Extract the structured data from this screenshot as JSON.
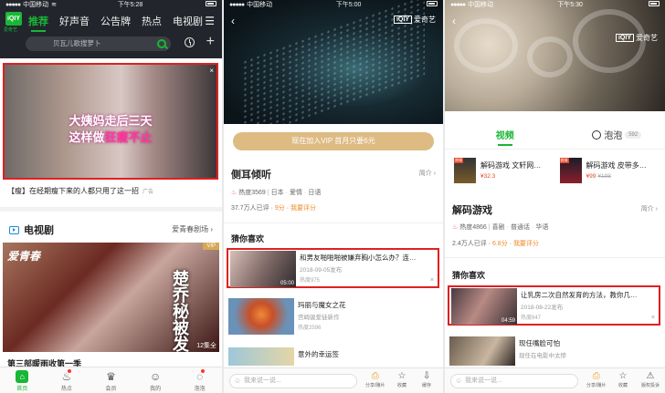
{
  "left": {
    "status": {
      "carrier": "中国移动",
      "time": "下午5:28"
    },
    "logo": {
      "text": "iQIY",
      "sub": "爱奇艺"
    },
    "nav": [
      "推荐",
      "好声音",
      "公告牌",
      "热点",
      "电视剧"
    ],
    "search_placeholder": "贝瓦儿歌搜萝卜",
    "ad": {
      "line1": "大姨妈走后三天",
      "line2a": "这样做",
      "line2b": "狂瘦不止",
      "close": "×"
    },
    "ad_caption": "【瘦】在经期瘦下来的人都只用了这一招",
    "ad_tag": "广告",
    "section": {
      "title": "电视剧",
      "more": "爱青春剧场"
    },
    "drama": {
      "vip": "VIP",
      "logo": "爱青春",
      "callig": "楚乔秘被发",
      "episodes": "12集全",
      "title": "第三部暖雨收第一季"
    },
    "tabbar": [
      {
        "label": "首页",
        "icon": "home"
      },
      {
        "label": "热点",
        "icon": "fire"
      },
      {
        "label": "会员",
        "icon": "crown"
      },
      {
        "label": "我的",
        "icon": "user"
      },
      {
        "label": "泡泡",
        "icon": "bubble"
      }
    ]
  },
  "middle": {
    "status": {
      "carrier": "中国移动",
      "time": "下午5:00"
    },
    "back": "‹",
    "brand": {
      "box": "iQIY",
      "text": "爱奇艺"
    },
    "vip_bar": "现在加入VIP 首月只要6元",
    "title": "侧耳倾听",
    "intro": "简介",
    "meta": {
      "heat": "热度3569",
      "tags": [
        "日本",
        "爱情",
        "日语"
      ]
    },
    "score": {
      "count": "37.7万人已评",
      "rating": "9分",
      "cta": "我要评分"
    },
    "guess_title": "猜你喜欢",
    "cards": [
      {
        "title": "和男友啪啪啪被嫌弃胸小怎么办？连…",
        "date": "2018-09-05发布",
        "heat": "热度975",
        "duration": "05:00",
        "close": "×"
      },
      {
        "title": "玛丽与魔女之花",
        "date": "宫崎骏爱徒新作",
        "heat": "热度2596",
        "duration": "",
        "close": ""
      },
      {
        "title": "意外的幸运签",
        "date": "",
        "heat": "",
        "duration": "",
        "close": ""
      }
    ],
    "comment_placeholder": "我来说一说...",
    "actions": [
      {
        "label": "分享/赚片",
        "icon": "share"
      },
      {
        "label": "收藏",
        "icon": "star"
      },
      {
        "label": "缓存",
        "icon": "download"
      }
    ]
  },
  "right": {
    "status": {
      "carrier": "中国移动",
      "time": "下午5:30"
    },
    "back": "‹",
    "brand": {
      "box": "iQIY",
      "text": "爱奇艺"
    },
    "tabs": {
      "video": "视频",
      "bubble": "泡泡",
      "bubble_count": "592"
    },
    "games": [
      {
        "name": "解码游戏 文轩网…",
        "price": "¥32.3",
        "old": "",
        "badge": "商城"
      },
      {
        "name": "解码游戏 皮带多…",
        "price": "¥99",
        "old": "¥198",
        "badge": "商城"
      }
    ],
    "title": "解码游戏",
    "intro": "简介",
    "meta": {
      "heat": "热度4866",
      "tags": [
        "喜剧",
        "普通话",
        "华语"
      ]
    },
    "score": {
      "count": "2.4万人已评",
      "rating": "6.8分",
      "cta": "我要评分"
    },
    "guess_title": "猜你喜欢",
    "cards": [
      {
        "title": "让乳房二次自然发育的方法，教你几…",
        "date": "2018-08-22发布",
        "heat": "热度647",
        "duration": "04:59",
        "close": "×"
      },
      {
        "title": "现任嘴脸可怕",
        "date": "现任在电影中太惨",
        "heat": "",
        "duration": "",
        "close": ""
      }
    ],
    "comment_placeholder": "我来说一说...",
    "actions": [
      {
        "label": "分享/赚片",
        "icon": "share"
      },
      {
        "label": "收藏",
        "icon": "star"
      },
      {
        "label": "版权投诉",
        "icon": "report"
      }
    ],
    "colors": {
      "brand": "#1ab636",
      "alert": "#e02020",
      "vip": "#ddbb83",
      "score": "#f08a24"
    }
  }
}
